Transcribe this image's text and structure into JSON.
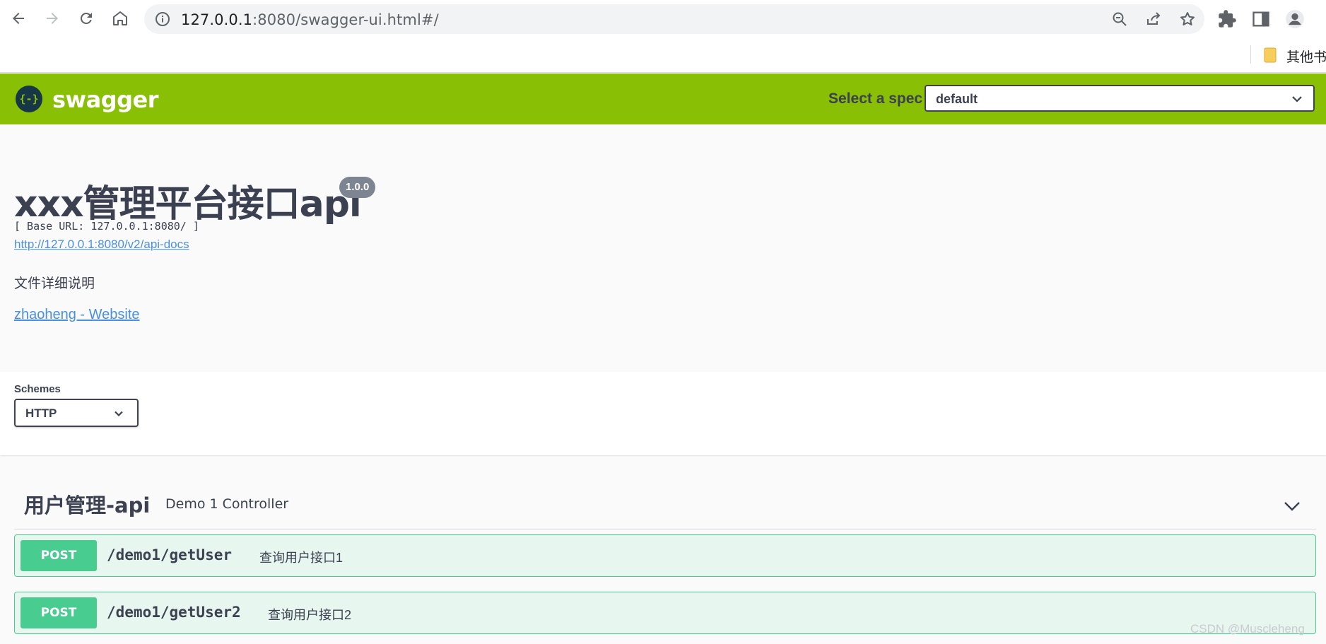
{
  "browser": {
    "url_host": "127.0.0.1",
    "url_rest": ":8080/swagger-ui.html#/",
    "bookmark_label": "其他书"
  },
  "topbar": {
    "logo_text": "swagger",
    "logo_glyph": "{-}",
    "spec_label": "Select a spec",
    "spec_value": "default",
    "color": "#89bf04"
  },
  "info": {
    "title": "xxx管理平台接口api",
    "version": "1.0.0",
    "base_url": "[ Base URL: 127.0.0.1:8080/ ]",
    "api_docs_link": "http://127.0.0.1:8080/v2/api-docs",
    "description": "文件详细说明",
    "contact_link": "zhaoheng - Website"
  },
  "schemes": {
    "label": "Schemes",
    "value": "HTTP"
  },
  "operations": {
    "tag": {
      "name": "用户管理-api",
      "description": "Demo 1 Controller"
    },
    "items": [
      {
        "method": "POST",
        "path": "/demo1/getUser",
        "summary": "查询用户接口1"
      },
      {
        "method": "POST",
        "path": "/demo1/getUser2",
        "summary": "查询用户接口2"
      }
    ],
    "post_color": "#49cc90"
  },
  "watermark": "CSDN @Muscleheng"
}
